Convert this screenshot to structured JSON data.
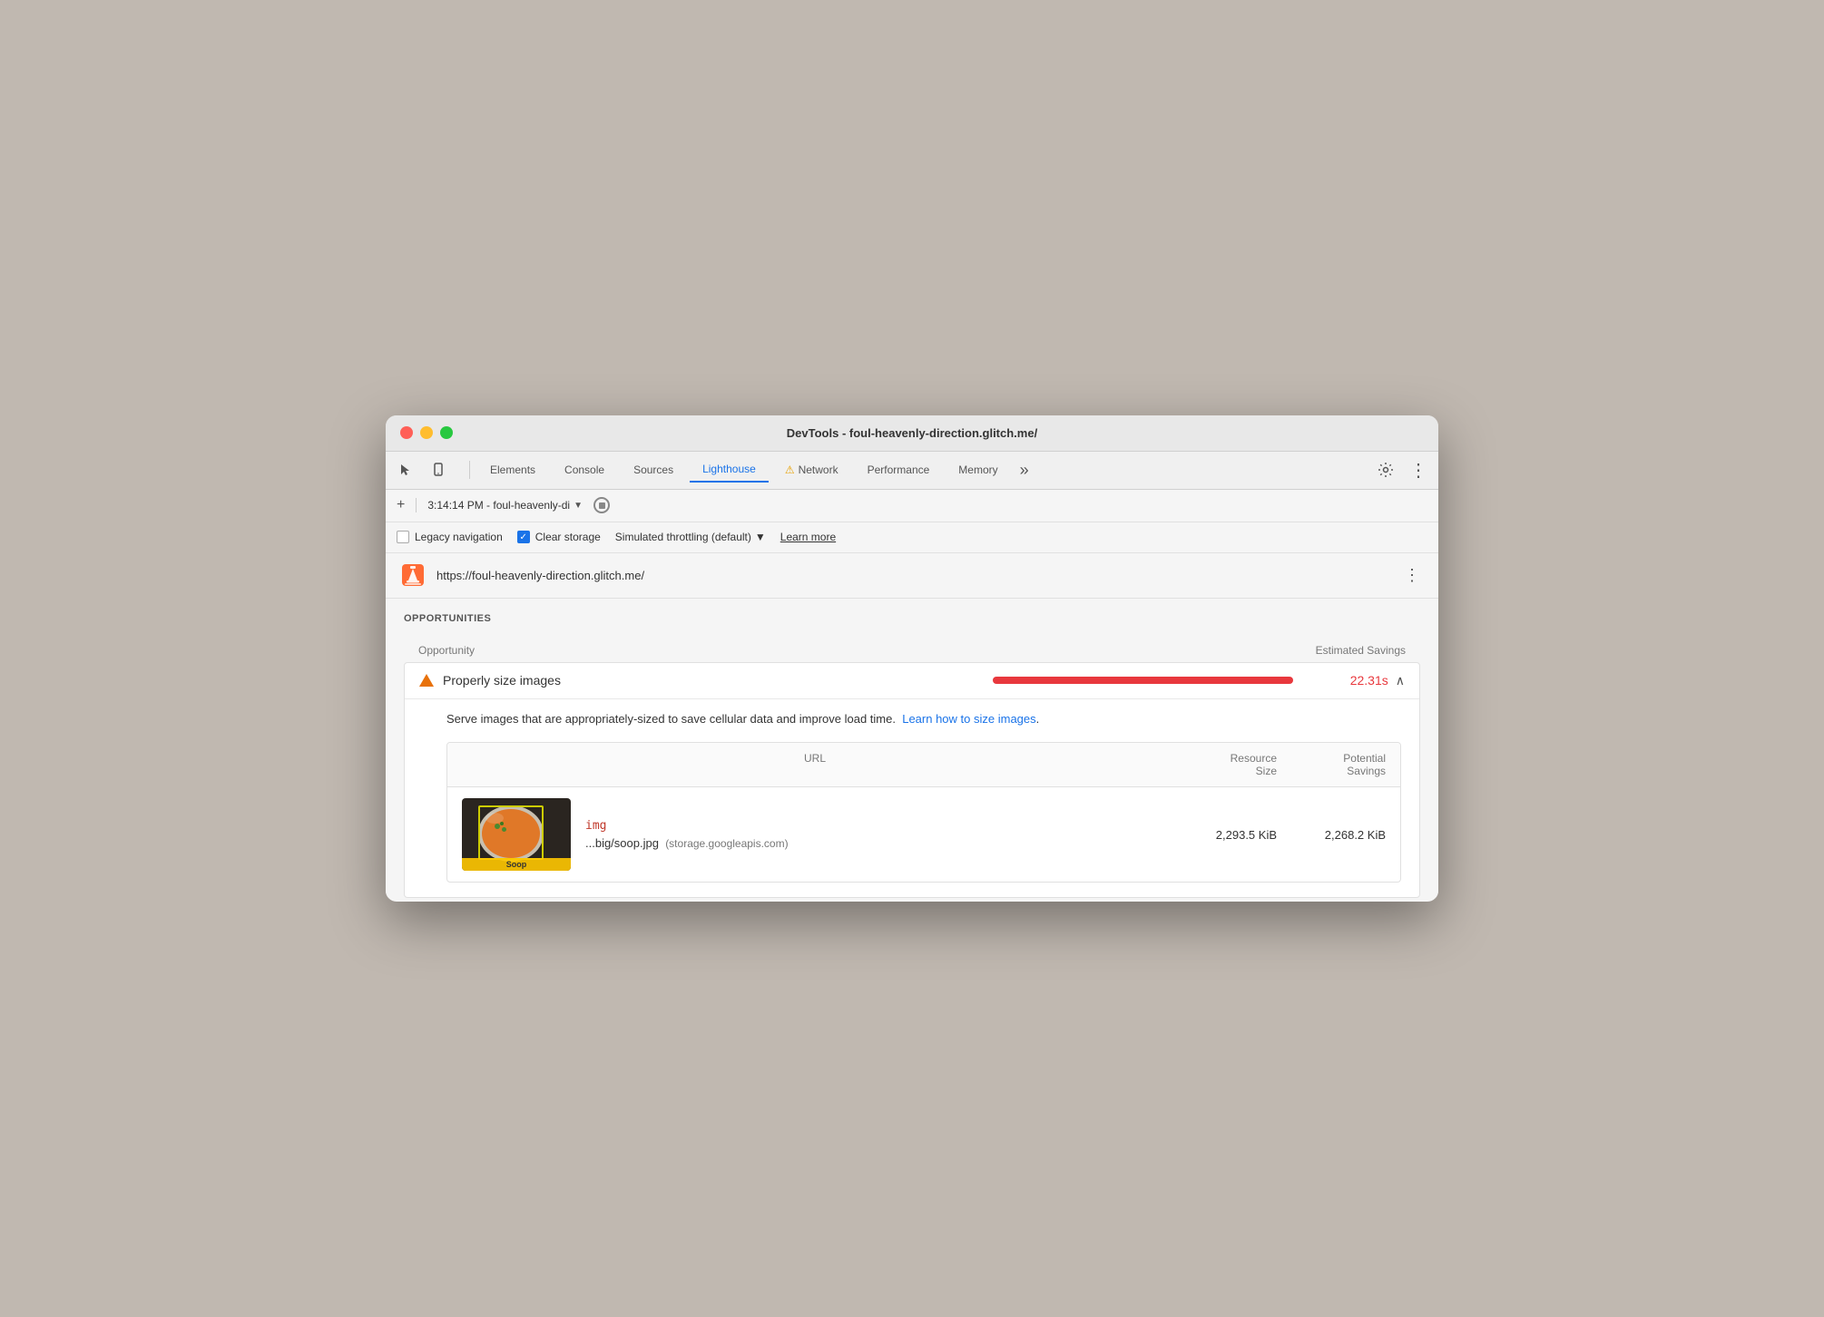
{
  "window": {
    "title": "DevTools - foul-heavenly-direction.glitch.me/"
  },
  "tabs": {
    "items": [
      {
        "id": "elements",
        "label": "Elements",
        "active": false
      },
      {
        "id": "console",
        "label": "Console",
        "active": false
      },
      {
        "id": "sources",
        "label": "Sources",
        "active": false
      },
      {
        "id": "lighthouse",
        "label": "Lighthouse",
        "active": true
      },
      {
        "id": "network",
        "label": "Network",
        "active": false,
        "has_warning": true
      },
      {
        "id": "performance",
        "label": "Performance",
        "active": false
      },
      {
        "id": "memory",
        "label": "Memory",
        "active": false
      }
    ],
    "more_label": "»"
  },
  "secondary_toolbar": {
    "add_label": "+",
    "session_text": "3:14:14 PM - foul-heavenly-di",
    "dropdown_label": "▼"
  },
  "options_bar": {
    "legacy_navigation_label": "Legacy navigation",
    "clear_storage_label": "Clear storage",
    "throttling_label": "Simulated throttling (default)",
    "learn_more_label": "Learn more"
  },
  "url_bar": {
    "url": "https://foul-heavenly-direction.glitch.me/"
  },
  "opportunities": {
    "section_title": "OPPORTUNITIES",
    "table_header_opportunity": "Opportunity",
    "table_header_savings": "Estimated Savings",
    "items": [
      {
        "id": "properly-size-images",
        "icon": "▲",
        "title": "Properly size images",
        "savings": "22.31s",
        "bar_width_percent": 92,
        "expanded": true,
        "description": "Serve images that are appropriately-sized to save cellular data and improve load time.",
        "learn_how_link": "Learn how to size images",
        "learn_how_url": "#",
        "table": {
          "col_url": "URL",
          "col_resource_size": "Resource\nSize",
          "col_potential_savings": "Potential\nSavings",
          "rows": [
            {
              "element_tag": "img",
              "filename": "...big/soop.jpg",
              "domain": "(storage.googleapis.com)",
              "resource_size": "2,293.5 KiB",
              "potential_savings": "2,268.2 KiB",
              "thumbnail_label": "Soop"
            }
          ]
        }
      }
    ]
  },
  "icons": {
    "cursor": "↖",
    "mobile": "📱",
    "settings": "⚙",
    "more_vert": "⋮",
    "stop_circle": "⊘",
    "chevron_up": "∧",
    "warning": "⚠"
  }
}
